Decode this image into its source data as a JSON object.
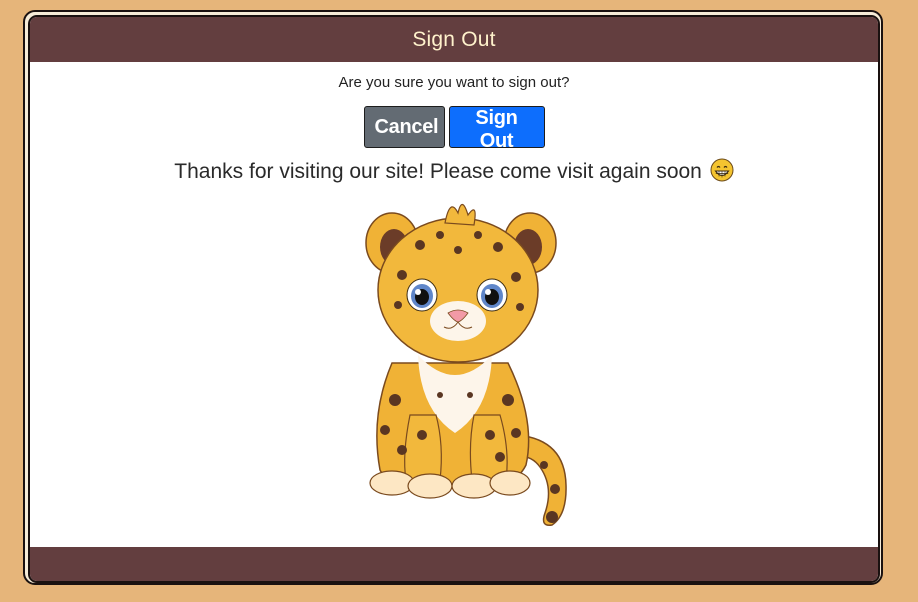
{
  "modal": {
    "title": "Sign Out",
    "question": "Are you sure you want to sign out?",
    "cancel_label": "Cancel",
    "signout_label": "Sign Out",
    "thanks_message": "Thanks for visiting our site! Please come visit again soon",
    "emoji_icon": "grinning-face-icon",
    "image": "leopard-cub-illustration"
  },
  "colors": {
    "page_background": "#e6b57a",
    "header_footer": "#633e3f",
    "title_text": "#fff2cc",
    "cancel_button": "#636b73",
    "signout_button": "#0d6efd"
  }
}
